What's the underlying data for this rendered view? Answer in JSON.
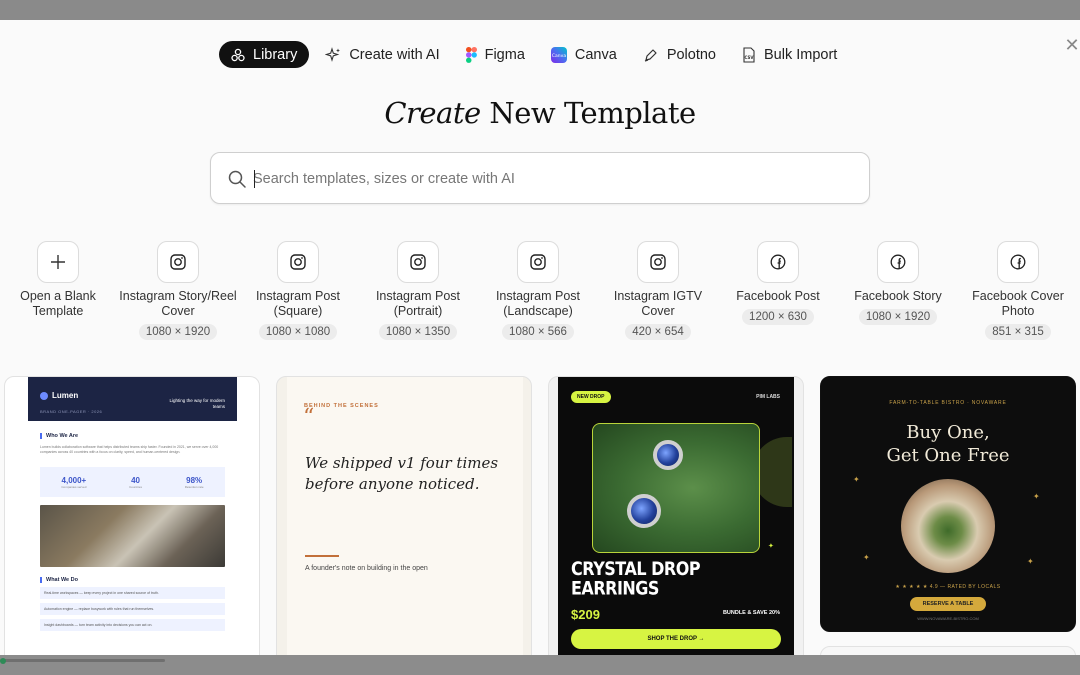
{
  "tabs": [
    {
      "label": "Library",
      "icon": "library-icon",
      "active": true
    },
    {
      "label": "Create with AI",
      "icon": "sparkle-icon",
      "active": false
    },
    {
      "label": "Figma",
      "icon": "figma-icon",
      "active": false
    },
    {
      "label": "Canva",
      "icon": "canva-icon",
      "active": false
    },
    {
      "label": "Polotno",
      "icon": "pen-icon",
      "active": false
    },
    {
      "label": "Bulk Import",
      "icon": "csv-file-icon",
      "active": false
    }
  ],
  "title": {
    "emphasis": "Create",
    "rest": "New Template"
  },
  "search": {
    "placeholder": "Search templates, sizes or create with AI",
    "value": ""
  },
  "sizes": [
    {
      "label": "Open a Blank Template",
      "dims": "",
      "icon": "plus-icon"
    },
    {
      "label": "Instagram Story/Reel Cover",
      "dims": "1080 × 1920",
      "icon": "instagram-icon"
    },
    {
      "label": "Instagram Post (Square)",
      "dims": "1080 × 1080",
      "icon": "instagram-icon"
    },
    {
      "label": "Instagram Post (Portrait)",
      "dims": "1080 × 1350",
      "icon": "instagram-icon"
    },
    {
      "label": "Instagram Post (Landscape)",
      "dims": "1080 × 566",
      "icon": "instagram-icon"
    },
    {
      "label": "Instagram IGTV Cover",
      "dims": "420 × 654",
      "icon": "instagram-icon"
    },
    {
      "label": "Facebook Post",
      "dims": "1200 × 630",
      "icon": "facebook-icon"
    },
    {
      "label": "Facebook Story",
      "dims": "1080 × 1920",
      "icon": "facebook-icon"
    },
    {
      "label": "Facebook Cover Photo",
      "dims": "851 × 315",
      "icon": "facebook-icon"
    }
  ],
  "cards": {
    "lumen": {
      "brand": "Lumen",
      "tagline": "Lighting the way for modern teams",
      "subline": "BRAND ONE-PAGER · 2026",
      "section1": "Who We Are",
      "para": "Lumen builds collaboration software that helps distributed teams ship faster. Founded in 2021, we serve over 4,000 companies across 40 countries with a focus on clarity, speed, and human-centered design.",
      "stats": [
        {
          "value": "4,000+",
          "label": "Companies served"
        },
        {
          "value": "40",
          "label": "Countries"
        },
        {
          "value": "98%",
          "label": "Retention rate"
        }
      ],
      "section2": "What We Do",
      "rows": [
        "Real-time workspaces — keep every project in one shared source of truth.",
        "Automation engine — replace busywork with rules that run themselves.",
        "Insight dashboards — turn team activity into decisions you can act on."
      ]
    },
    "shipped": {
      "kicker": "BEHIND THE SCENES",
      "quote_mark": "“",
      "headline": "We shipped v1 four times before anyone noticed.",
      "note": "A founder's note on building in the open"
    },
    "crystal": {
      "badge": "NEW DROP",
      "lab": "PIM LABS",
      "name_line1": "CRYSTAL DROP",
      "name_line2": "EARRINGS",
      "price": "$209",
      "bundle": "BUNDLE & SAVE 20%",
      "cta": "SHOP THE DROP →"
    },
    "bistro": {
      "kicker": "FARM-TO-TABLE BISTRO · NOVAWARE",
      "headline_line1": "Buy One,",
      "headline_line2": "Get One Free",
      "rating": "★ ★ ★ ★ ★  4.9 — RATED BY LOCALS",
      "cta": "RESERVE A TABLE",
      "site": "WWW.NOVAWARE-BISTRO.COM"
    }
  },
  "colors": {
    "accent_lime": "#d7f442",
    "navy": "#1c2444",
    "gold": "#d4a93c",
    "rust": "#c2703a"
  }
}
